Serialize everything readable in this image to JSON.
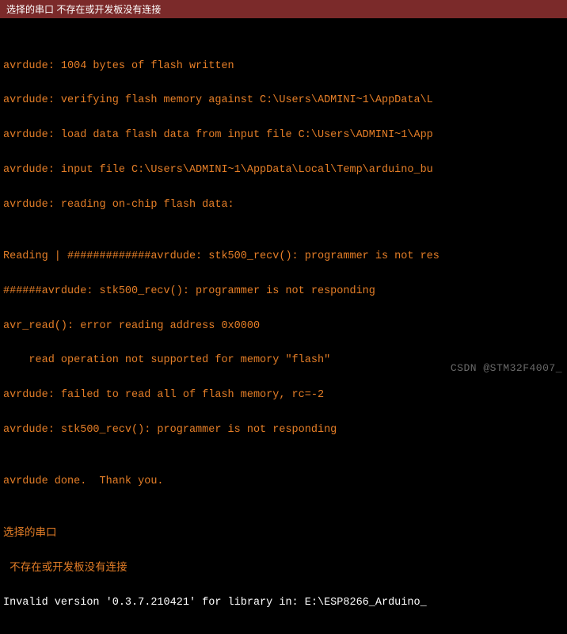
{
  "titlebar": {
    "text": "选择的串口  不存在或开发板没有连接"
  },
  "console": {
    "lines": [
      "",
      "avrdude: 1004 bytes of flash written",
      "avrdude: verifying flash memory against C:\\Users\\ADMINI~1\\AppData\\L",
      "avrdude: load data flash data from input file C:\\Users\\ADMINI~1\\App",
      "avrdude: input file C:\\Users\\ADMINI~1\\AppData\\Local\\Temp\\arduino_bu",
      "avrdude: reading on-chip flash data:",
      "",
      "Reading | #############avrdude: stk500_recv(): programmer is not res",
      "######avrdude: stk500_recv(): programmer is not responding",
      "avr_read(): error reading address 0x0000",
      "    read operation not supported for memory \"flash\"",
      "avrdude: failed to read all of flash memory, rc=-2",
      "avrdude: stk500_recv(): programmer is not responding",
      "",
      "avrdude done.  Thank you.",
      ""
    ],
    "footer_line1": "选择的串口",
    "footer_line2": " 不存在或开发板没有连接",
    "invalid_line": "Invalid version '0.3.7.210421' for library in: E:\\ESP8266_Arduino_"
  },
  "watermark": "CSDN @STM32F4007_"
}
